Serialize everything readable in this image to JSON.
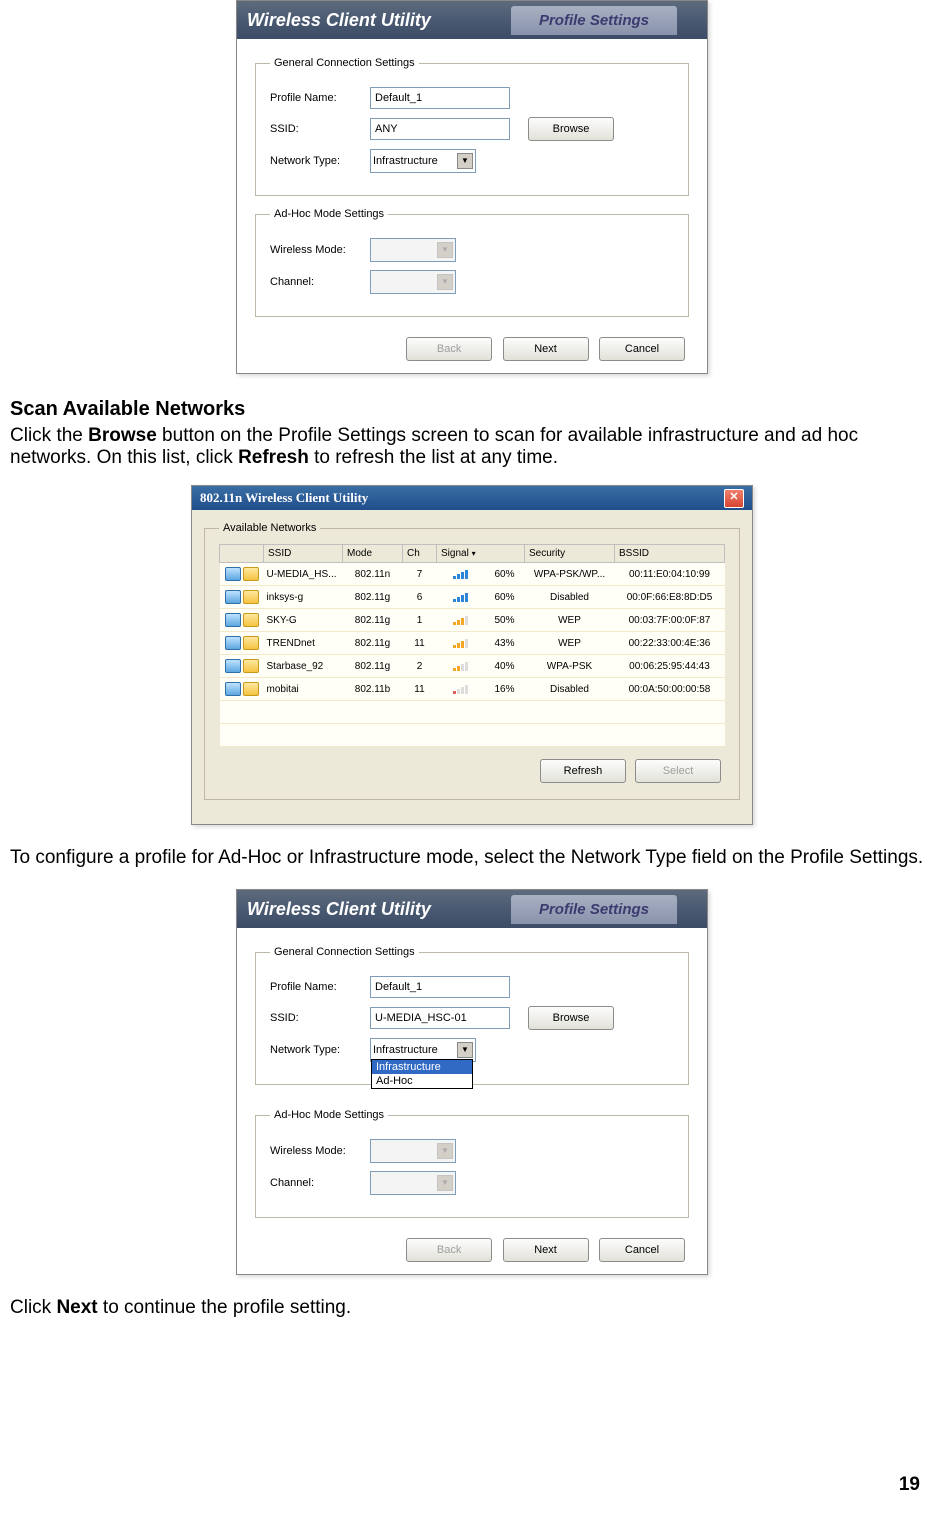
{
  "page_number": "19",
  "section_heading": "Scan Available Networks",
  "paragraph1_a": "Click the ",
  "paragraph1_b": "Browse",
  "paragraph1_c": " button on the Profile Settings screen to scan for available infrastructure and ad hoc networks. On this list, click ",
  "paragraph1_d": "Refresh",
  "paragraph1_e": " to refresh the list at any time.",
  "paragraph2": "To configure a profile for Ad-Hoc or Infrastructure mode, select the Network Type field on the Profile Settings.",
  "paragraph3_a": "Click ",
  "paragraph3_b": "Next",
  "paragraph3_c": " to continue the profile setting.",
  "app": {
    "title": "Wireless Client Utility",
    "tab": "Profile Settings",
    "legend_general": "General Connection Settings",
    "legend_adhoc": "Ad-Hoc Mode Settings",
    "lbl_profile": "Profile Name:",
    "lbl_ssid": "SSID:",
    "lbl_nettype": "Network Type:",
    "lbl_wmode": "Wireless Mode:",
    "lbl_channel": "Channel:",
    "btn_browse": "Browse",
    "btn_back": "Back",
    "btn_next": "Next",
    "btn_cancel": "Cancel"
  },
  "screenshot1": {
    "profile_name_value": "Default_1",
    "ssid_value": "ANY",
    "nettype_value": "Infrastructure"
  },
  "screenshot3": {
    "profile_name_value": "Default_1",
    "ssid_value": "U-MEDIA_HSC-01",
    "nettype_value": "Infrastructure",
    "dd_option1": "Infrastructure",
    "dd_option2": "Ad-Hoc"
  },
  "scan": {
    "title": "802.11n  Wireless Client Utility",
    "legend": "Available Networks",
    "btn_refresh": "Refresh",
    "btn_select": "Select",
    "cols": {
      "ssid": "SSID",
      "mode": "Mode",
      "ch": "Ch",
      "signal": "Signal",
      "security": "Security",
      "bssid": "BSSID"
    },
    "rows": [
      {
        "ssid": "U-MEDIA_HS...",
        "mode": "802.11n",
        "ch": "7",
        "signal": "60%",
        "security": "WPA-PSK/WP...",
        "bssid": "00:11:E0:04:10:99",
        "bars": 4
      },
      {
        "ssid": "inksys-g",
        "mode": "802.11g",
        "ch": "6",
        "signal": "60%",
        "security": "Disabled",
        "bssid": "00:0F:66:E8:8D:D5",
        "bars": 4
      },
      {
        "ssid": "SKY-G",
        "mode": "802.11g",
        "ch": "1",
        "signal": "50%",
        "security": "WEP",
        "bssid": "00:03:7F:00:0F:87",
        "bars": 3
      },
      {
        "ssid": "TRENDnet",
        "mode": "802.11g",
        "ch": "11",
        "signal": "43%",
        "security": "WEP",
        "bssid": "00:22:33:00:4E:36",
        "bars": 3
      },
      {
        "ssid": "Starbase_92",
        "mode": "802.11g",
        "ch": "2",
        "signal": "40%",
        "security": "WPA-PSK",
        "bssid": "00:06:25:95:44:43",
        "bars": 2
      },
      {
        "ssid": "mobitai",
        "mode": "802.11b",
        "ch": "11",
        "signal": "16%",
        "security": "Disabled",
        "bssid": "00:0A:50:00:00:58",
        "bars": 1
      }
    ]
  }
}
